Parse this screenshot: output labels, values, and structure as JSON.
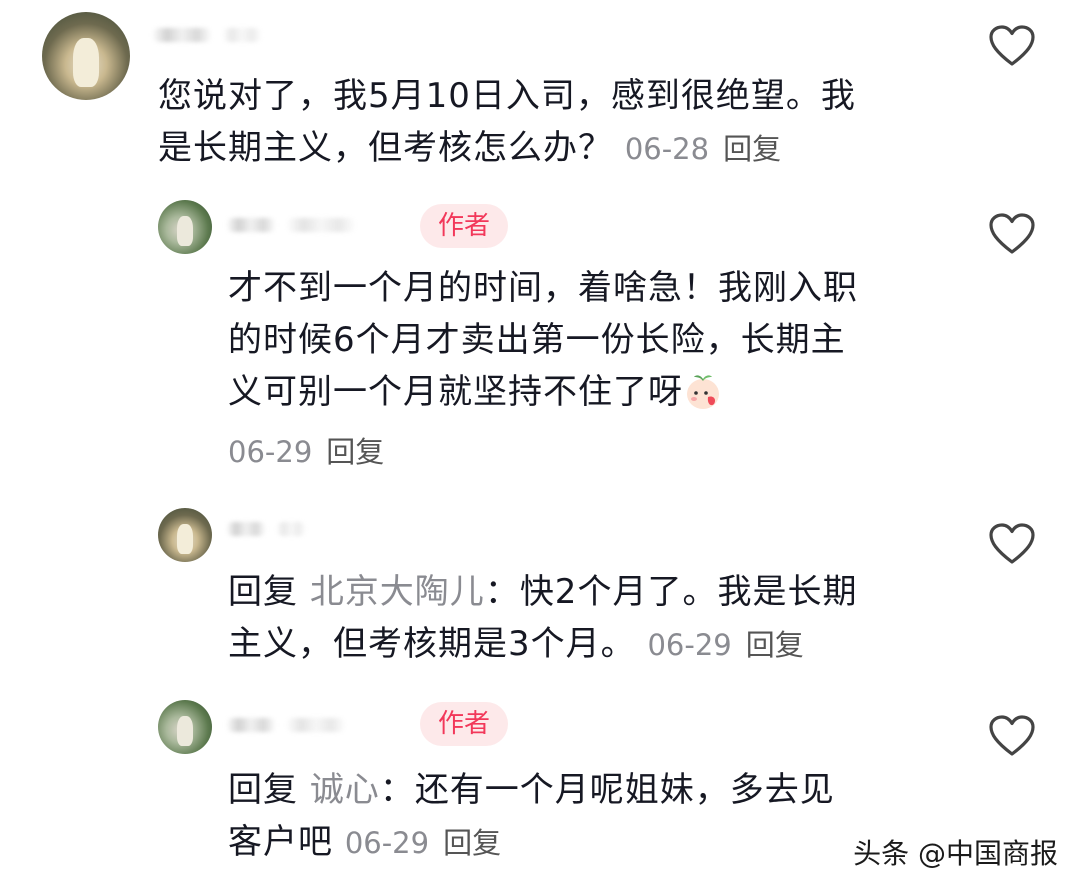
{
  "comments": [
    {
      "text": "您说对了，我5月10日入司，感到很绝望。我是长期主义，但考核怎么办？",
      "line1": "您说对了，我5月10日入司，感到很绝望。我",
      "line2": "是长期主义，但考核怎么办？",
      "date": "06-28",
      "reply_label": "回复"
    },
    {
      "author_badge": "作者",
      "line1": "才不到一个月的时间，着啥急！我刚入职",
      "line2": "的时候6个月才卖出第一份长险，长期主",
      "line3": "义可别一个月就坚持不住了呀",
      "emoji": "peach-face-emoji",
      "date": "06-29",
      "reply_label": "回复"
    },
    {
      "reply_prefix": "回复",
      "reply_to": "北京大陶儿",
      "line1_rest": "快2个月了。我是长期",
      "line2": "主义，但考核期是3个月。",
      "date": "06-29",
      "reply_label": "回复"
    },
    {
      "author_badge": "作者",
      "reply_prefix": "回复",
      "reply_to": "诚心",
      "line1_rest": "还有一个月呢姐妹，多去见",
      "line2": "客户吧",
      "date": "06-29",
      "reply_label": "回复"
    }
  ],
  "watermark": "头条 @中国商报",
  "icons": {
    "like": "heart-outline-icon"
  },
  "colors": {
    "badge_bg": "#fde9ea",
    "badge_text": "#f2385a",
    "meta_text": "#8a8b91",
    "body_text": "#161823"
  }
}
